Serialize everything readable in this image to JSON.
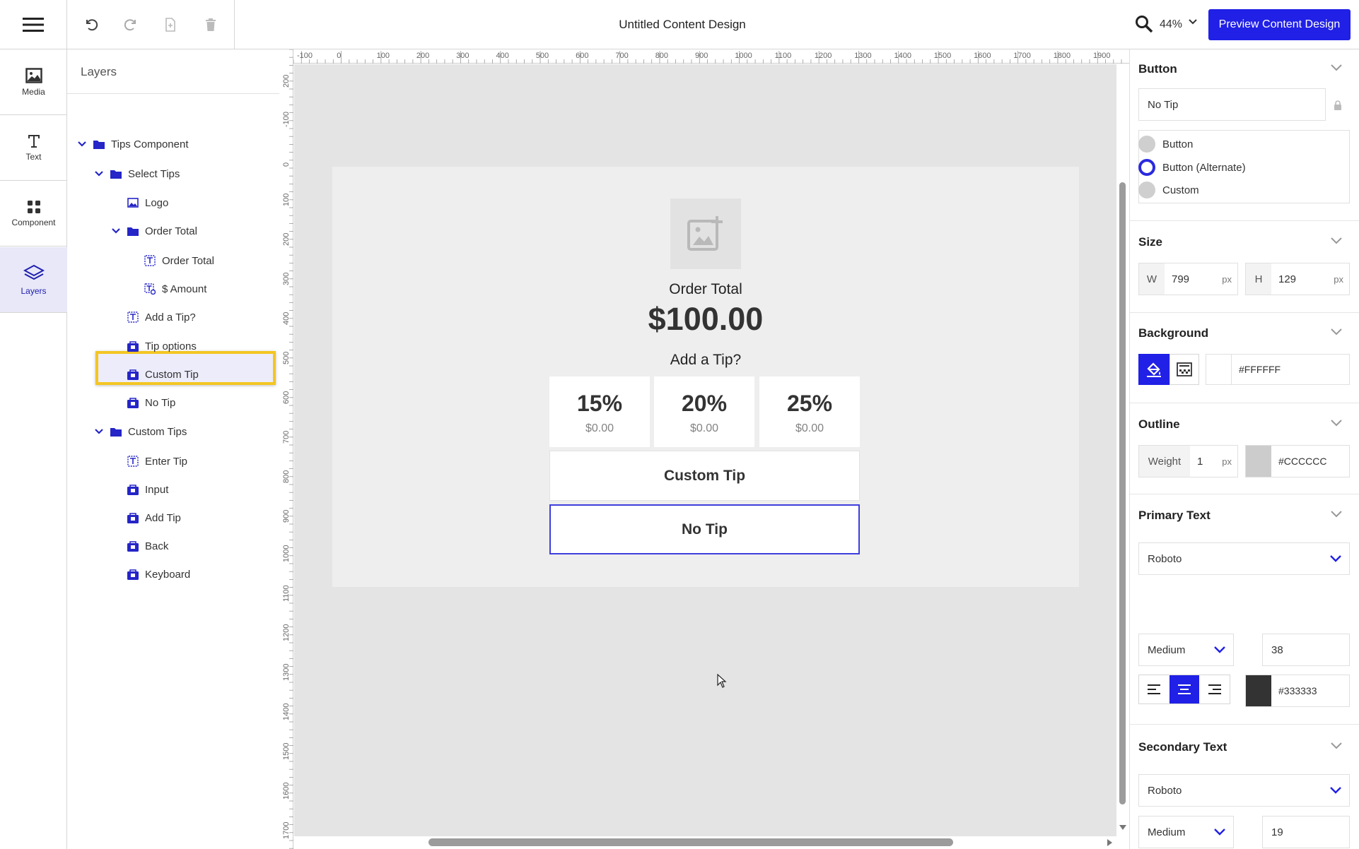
{
  "topbar": {
    "title": "Untitled Content Design",
    "zoom": "44%",
    "preview_label": "Preview Content Design"
  },
  "rail": {
    "items": [
      {
        "label": "Media",
        "icon": "image-icon"
      },
      {
        "label": "Text",
        "icon": "text-icon"
      },
      {
        "label": "Component",
        "icon": "grid-icon"
      },
      {
        "label": "Layers",
        "icon": "layers-icon"
      }
    ]
  },
  "layers": {
    "title": "Layers",
    "tree": [
      {
        "label": "Tips Component",
        "icon": "folder-icon"
      },
      {
        "label": "Select Tips",
        "icon": "folder-icon"
      },
      {
        "label": "Logo",
        "icon": "image-layer-icon"
      },
      {
        "label": "Order Total",
        "icon": "folder-icon"
      },
      {
        "label": "Order Total",
        "icon": "text-layer-icon"
      },
      {
        "label": "$ Amount",
        "icon": "dynamic-text-icon"
      },
      {
        "label": "Add a Tip?",
        "icon": "text-layer-icon"
      },
      {
        "label": "Tip options",
        "icon": "button-layer-icon"
      },
      {
        "label": "Custom Tip",
        "icon": "button-layer-icon"
      },
      {
        "label": "No Tip",
        "icon": "button-layer-icon"
      },
      {
        "label": "Custom Tips",
        "icon": "folder-icon"
      },
      {
        "label": "Enter Tip",
        "icon": "text-layer-icon"
      },
      {
        "label": "Input",
        "icon": "button-layer-icon"
      },
      {
        "label": "Add Tip",
        "icon": "button-layer-icon"
      },
      {
        "label": "Back",
        "icon": "button-layer-icon"
      },
      {
        "label": "Keyboard",
        "icon": "button-layer-icon"
      }
    ]
  },
  "rulers": {
    "h_ticks": [
      "-100",
      "0",
      "100",
      "200",
      "300",
      "400",
      "500",
      "600",
      "700",
      "800",
      "900",
      "1000",
      "1100",
      "1200",
      "1300",
      "1400",
      "1500",
      "1600",
      "1700",
      "1800",
      "1900",
      "200"
    ],
    "v_ticks": [
      "200",
      "-100",
      "0",
      "100",
      "200",
      "300",
      "400",
      "500",
      "600",
      "700",
      "800",
      "900",
      "1000",
      "1100",
      "1200",
      "1300",
      "1400",
      "1500",
      "1600",
      "1700",
      "0"
    ]
  },
  "canvas": {
    "order_total_label": "Order Total",
    "order_amount": "$100.00",
    "add_tip_label": "Add a Tip?",
    "tips": [
      {
        "percent": "15%",
        "amount": "$0.00"
      },
      {
        "percent": "20%",
        "amount": "$0.00"
      },
      {
        "percent": "25%",
        "amount": "$0.00"
      }
    ],
    "custom_tip_label": "Custom Tip",
    "no_tip_label": "No Tip"
  },
  "props": {
    "button": {
      "title": "Button",
      "name_value": "No Tip",
      "styles": [
        {
          "label": "Button",
          "selected": false
        },
        {
          "label": "Button (Alternate)",
          "selected": true
        },
        {
          "label": "Custom",
          "selected": false
        }
      ]
    },
    "size": {
      "title": "Size",
      "w_label": "W",
      "w_value": "799",
      "h_label": "H",
      "h_value": "129",
      "unit": "px"
    },
    "background": {
      "title": "Background",
      "color": "#FFFFFF"
    },
    "outline": {
      "title": "Outline",
      "weight_label": "Weight",
      "weight_value": "1",
      "unit": "px",
      "color": "#CCCCCC"
    },
    "primary_text": {
      "title": "Primary Text",
      "font": "Roboto",
      "weight": "Medium",
      "size": "38",
      "color": "#333333"
    },
    "secondary_text": {
      "title": "Secondary Text",
      "font": "Roboto",
      "weight": "Medium",
      "size": "19",
      "color": "#838383"
    }
  },
  "colors": {
    "accent": "#2020e6",
    "highlight": "#f3c623"
  }
}
